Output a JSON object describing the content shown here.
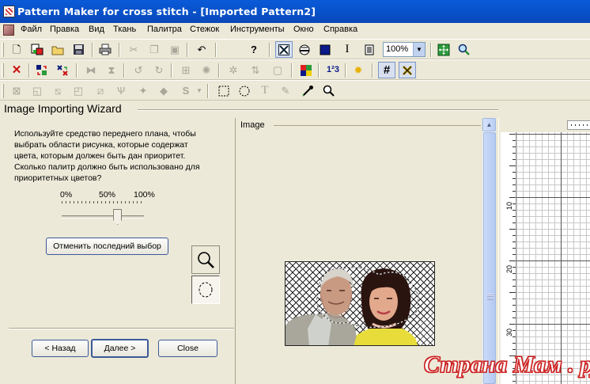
{
  "window": {
    "title": "Pattern Maker for cross stitch - [Imported Pattern2]"
  },
  "menu": [
    "Файл",
    "Правка",
    "Вид",
    "Ткань",
    "Палитра",
    "Стежок",
    "Инструменты",
    "Окно",
    "Справка"
  ],
  "toolbar": {
    "zoom_value": "100%",
    "icons_row1": [
      "new-icon",
      "open-colored-icon",
      "open-folder-icon",
      "save-icon",
      "print-icon",
      "cut-icon",
      "copy-icon",
      "paste-icon",
      "undo-icon",
      "help-icon",
      "full-stitch-icon",
      "half-stitch-icon",
      "filled-square-icon",
      "text-cursor-icon",
      "properties-icon",
      "zoom-fit-icon",
      "zoom-tool-icon"
    ],
    "icons_row2": [
      "delete-icon",
      "swap-colors-icon",
      "replace-color-icon",
      "flip-horizontal-icon",
      "flip-vertical-icon",
      "rotate-left-icon",
      "rotate-right-icon",
      "grid-sel-icon",
      "bug-icon",
      "asterisk-icon",
      "arrows-icon",
      "select-square-icon",
      "palette-grid-icon",
      "numbers-icon",
      "sun-icon",
      "grid-icon",
      "cross-icon"
    ],
    "icons_row3": [
      "stitch-1-icon",
      "stitch-2-icon",
      "stitch-3-icon",
      "stitch-4-icon",
      "stitch-5-icon",
      "stitch-6-icon",
      "stitch-7-icon",
      "s-stitch-icon",
      "rect-select-icon",
      "ellipse-select-icon",
      "text-tool-icon",
      "lasso-icon",
      "eyedropper-icon",
      "magnifier-icon"
    ]
  },
  "wizard": {
    "title": "Image Importing Wizard",
    "instructions": [
      "Используйте средство переднего плана, чтобы",
      "выбрать области рисунка, которые содержат",
      "цвета, которым должен быть дан приоритет.",
      "Сколько палитр должно быть использовано для",
      "приоритетных цветов?"
    ],
    "slider_labels": [
      "0%",
      "50%",
      "100%"
    ],
    "slider_value_percent": 70,
    "undo_selection_label": "Отменить последний выбор",
    "back_label": "< Назад",
    "next_label": "Далее >",
    "close_label": "Close"
  },
  "image_panel": {
    "label": "Image"
  },
  "grid": {
    "ruler_labels": [
      "10",
      "20",
      "30"
    ]
  },
  "watermark": "Страна Мам . ру",
  "colors": {
    "titlebar": "#0850c8",
    "chrome": "#ece9d8",
    "watermark_outline": "#cc2222"
  }
}
